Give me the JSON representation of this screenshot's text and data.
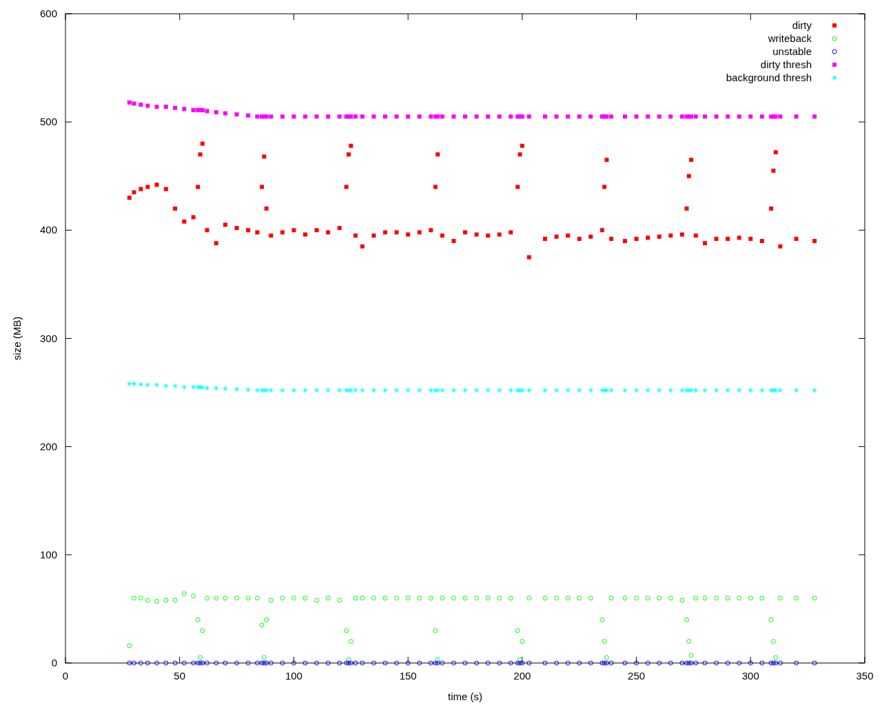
{
  "chart_data": {
    "type": "scatter",
    "xlabel": "time (s)",
    "ylabel": "size (MB)",
    "legend": true,
    "xlim": [
      0,
      350
    ],
    "ylim": [
      0,
      600
    ],
    "xticks": [
      0,
      50,
      100,
      150,
      200,
      250,
      300,
      350
    ],
    "yticks": [
      0,
      100,
      200,
      300,
      400,
      500,
      600
    ],
    "x": [
      28,
      30,
      33,
      36,
      40,
      44,
      48,
      52,
      56,
      58,
      59,
      60,
      62,
      66,
      70,
      75,
      80,
      84,
      86,
      87,
      88,
      90,
      95,
      100,
      105,
      110,
      115,
      120,
      123,
      124,
      125,
      127,
      130,
      135,
      140,
      145,
      150,
      155,
      160,
      162,
      163,
      165,
      170,
      175,
      180,
      185,
      190,
      195,
      198,
      199,
      200,
      203,
      210,
      215,
      220,
      225,
      230,
      235,
      236,
      237,
      239,
      245,
      250,
      255,
      260,
      265,
      270,
      272,
      273,
      274,
      276,
      280,
      285,
      290,
      295,
      300,
      305,
      309,
      310,
      311,
      313,
      320,
      328
    ],
    "series": [
      {
        "name": "dirty",
        "color": "#ff0000",
        "marker": "square",
        "values": [
          430,
          435,
          438,
          440,
          442,
          438,
          420,
          408,
          412,
          440,
          470,
          480,
          400,
          388,
          405,
          402,
          400,
          398,
          440,
          468,
          420,
          395,
          398,
          400,
          396,
          400,
          398,
          402,
          440,
          470,
          478,
          395,
          385,
          395,
          398,
          398,
          396,
          398,
          400,
          440,
          470,
          395,
          390,
          398,
          396,
          395,
          396,
          398,
          440,
          470,
          478,
          375,
          392,
          394,
          395,
          392,
          394,
          400,
          440,
          465,
          392,
          390,
          392,
          393,
          394,
          395,
          396,
          420,
          450,
          465,
          395,
          388,
          392,
          392,
          393,
          392,
          390,
          420,
          455,
          472,
          385,
          392,
          390
        ]
      },
      {
        "name": "writeback",
        "color": "#00ff00",
        "marker": "circle",
        "values": [
          16,
          60,
          60,
          58,
          57,
          58,
          58,
          64,
          62,
          40,
          5,
          30,
          60,
          60,
          60,
          60,
          60,
          60,
          35,
          5,
          40,
          58,
          60,
          60,
          60,
          58,
          60,
          58,
          30,
          3,
          20,
          60,
          60,
          60,
          60,
          60,
          60,
          60,
          60,
          30,
          3,
          60,
          60,
          60,
          60,
          60,
          60,
          60,
          30,
          3,
          20,
          60,
          60,
          60,
          60,
          60,
          60,
          40,
          20,
          5,
          60,
          60,
          60,
          60,
          60,
          60,
          58,
          40,
          20,
          7,
          60,
          60,
          60,
          60,
          60,
          60,
          60,
          40,
          20,
          5,
          60,
          60,
          60
        ]
      },
      {
        "name": "unstable",
        "color": "#0000ff",
        "marker": "circle",
        "values": [
          0,
          0,
          0,
          0,
          0,
          0,
          0,
          0,
          0,
          0,
          0,
          0,
          0,
          0,
          0,
          0,
          0,
          0,
          0,
          0,
          0,
          0,
          0,
          0,
          0,
          0,
          0,
          0,
          0,
          0,
          0,
          0,
          0,
          0,
          0,
          0,
          0,
          0,
          0,
          0,
          0,
          0,
          0,
          0,
          0,
          0,
          0,
          0,
          0,
          0,
          0,
          0,
          0,
          0,
          0,
          0,
          0,
          0,
          0,
          0,
          0,
          0,
          0,
          0,
          0,
          0,
          0,
          0,
          0,
          0,
          0,
          0,
          0,
          0,
          0,
          0,
          0,
          0,
          0,
          0,
          0,
          0,
          0
        ]
      },
      {
        "name": "dirty thresh",
        "color": "#ff00ff",
        "marker": "square",
        "values": [
          518,
          517,
          516,
          515,
          514,
          514,
          513,
          512,
          511,
          511,
          511,
          511,
          510,
          509,
          508,
          507,
          506,
          505,
          505,
          505,
          505,
          505,
          505,
          505,
          505,
          505,
          505,
          505,
          505,
          505,
          505,
          505,
          505,
          505,
          505,
          505,
          505,
          505,
          505,
          505,
          505,
          505,
          505,
          505,
          505,
          505,
          505,
          505,
          505,
          505,
          505,
          505,
          505,
          505,
          505,
          505,
          505,
          505,
          505,
          505,
          505,
          505,
          505,
          505,
          505,
          505,
          505,
          505,
          505,
          505,
          505,
          505,
          505,
          505,
          505,
          505,
          505,
          505,
          505,
          505,
          505,
          505,
          505
        ]
      },
      {
        "name": "background thresh",
        "color": "#00ffff",
        "marker": "cross",
        "values": [
          258,
          258,
          257.5,
          257,
          257,
          256,
          256,
          255,
          255,
          255,
          255,
          254.5,
          254,
          254,
          253.5,
          253,
          252.5,
          252,
          252,
          252,
          252,
          252,
          252,
          252,
          252,
          252,
          252,
          252,
          252,
          252,
          252,
          252,
          252,
          252,
          252,
          252,
          252,
          252,
          252,
          252,
          252,
          252,
          252,
          252,
          252,
          252,
          252,
          252,
          252,
          252,
          252,
          252,
          252,
          252,
          252,
          252,
          252,
          252,
          252,
          252,
          252,
          252,
          252,
          252,
          252,
          252,
          252,
          252,
          252,
          252,
          252,
          252,
          252,
          252,
          252,
          252,
          252,
          252,
          252,
          252,
          252,
          252,
          252
        ]
      }
    ]
  }
}
